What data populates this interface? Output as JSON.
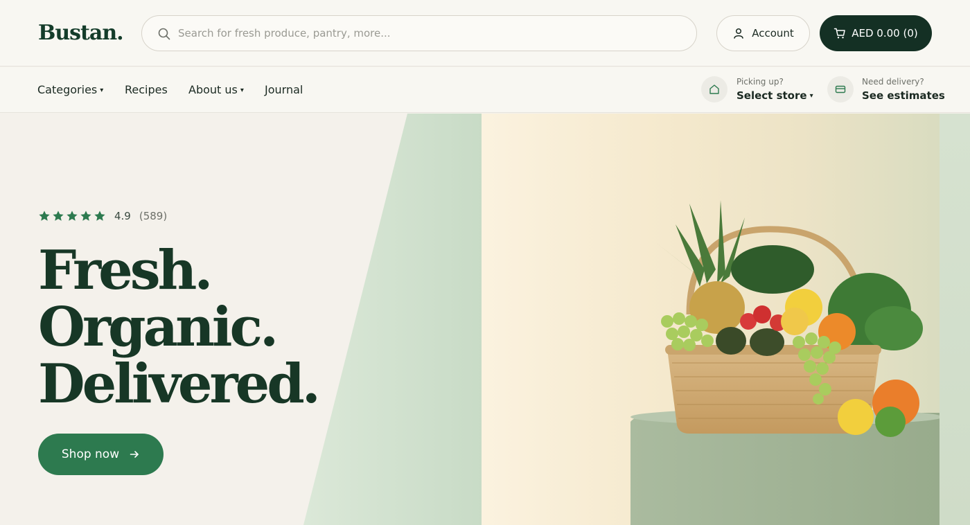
{
  "header": {
    "logo": "Bustan.",
    "search_placeholder": "Search for fresh produce, pantry, more...",
    "account_label": "Account",
    "cart_label": "AED 0.00 (0)"
  },
  "nav": {
    "items": [
      {
        "label": "Categories",
        "has_caret": true
      },
      {
        "label": "Recipes",
        "has_caret": false
      },
      {
        "label": "About us",
        "has_caret": true
      },
      {
        "label": "Journal",
        "has_caret": false
      }
    ],
    "pickup": {
      "small": "Picking up?",
      "label": "Select store"
    },
    "delivery": {
      "small": "Need delivery?",
      "label": "See estimates"
    }
  },
  "hero": {
    "rating_value": "4.9",
    "rating_count": "(589)",
    "stars": 5,
    "headline_lines": [
      "Fresh.",
      "Organic.",
      "Delivered."
    ],
    "cta_label": "Shop now"
  },
  "colors": {
    "brand_dark": "#143024",
    "brand_green": "#2d7a4f",
    "headline": "#173726",
    "background": "#f4f1eb"
  }
}
